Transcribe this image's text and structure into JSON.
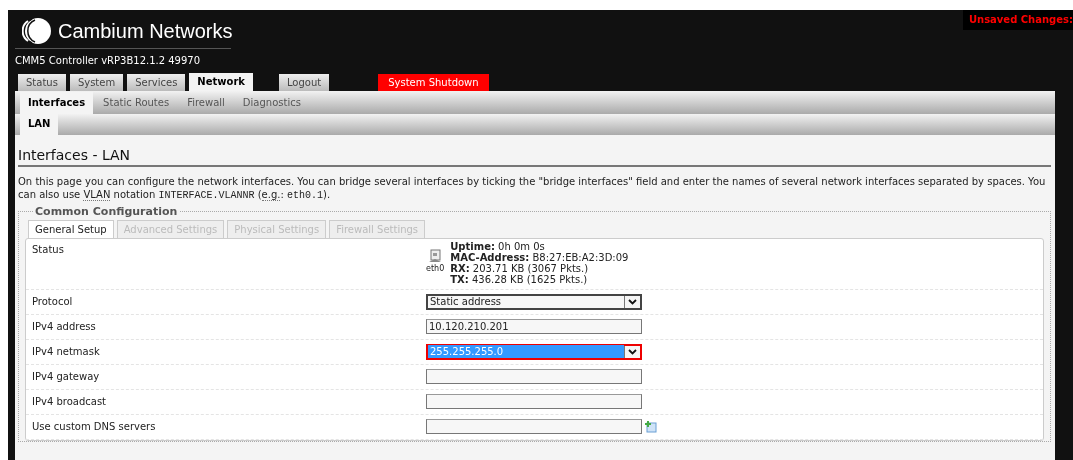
{
  "header": {
    "brand": "Cambium Networks",
    "subtitle": "CMM5 Controller vRP3B12.1.2 49970",
    "unsaved": "Unsaved Changes: "
  },
  "main_tabs": [
    {
      "label": "Status",
      "selected": false,
      "kind": "tab"
    },
    {
      "label": "System",
      "selected": false,
      "kind": "tab"
    },
    {
      "label": "Services",
      "selected": false,
      "kind": "tab"
    },
    {
      "label": "Network",
      "selected": true,
      "kind": "tab"
    },
    {
      "label": "Logout",
      "selected": false,
      "kind": "logout"
    },
    {
      "label": "System Shutdown",
      "selected": false,
      "kind": "danger"
    }
  ],
  "sub_tabs": [
    {
      "label": "Interfaces",
      "selected": true
    },
    {
      "label": "Static Routes",
      "selected": false
    },
    {
      "label": "Firewall",
      "selected": false
    },
    {
      "label": "Diagnostics",
      "selected": false
    }
  ],
  "iface_tabs": [
    {
      "label": "LAN",
      "selected": true
    }
  ],
  "page_title": "Interfaces - LAN",
  "description": [
    {
      "kind": "text",
      "text": "On this page you can configure the network interfaces. You can bridge several interfaces by ticking the \"bridge interfaces\" field and enter the names of several network interfaces separated by spaces. You can also use "
    },
    {
      "kind": "abbr",
      "text": "VLAN"
    },
    {
      "kind": "text",
      "text": " notation "
    },
    {
      "kind": "code",
      "text": "INTERFACE.VLANNR"
    },
    {
      "kind": "text",
      "text": " ("
    },
    {
      "kind": "abbr",
      "text": "e.g."
    },
    {
      "kind": "text",
      "text": ": "
    },
    {
      "kind": "code",
      "text": "eth0.1"
    },
    {
      "kind": "text",
      "text": ")."
    }
  ],
  "section": {
    "legend": "Common Configuration",
    "tabs": [
      {
        "label": "General Setup",
        "selected": true
      },
      {
        "label": "Advanced Settings",
        "selected": false
      },
      {
        "label": "Physical Settings",
        "selected": false
      },
      {
        "label": "Firewall Settings",
        "selected": false
      }
    ],
    "status": {
      "label": "Status",
      "device": "eth0",
      "lines": [
        {
          "label": "Uptime:",
          "value": " 0h 0m 0s"
        },
        {
          "label": "MAC-Address:",
          "value": " B8:27:EB:A2:3D:09"
        },
        {
          "label": "RX:",
          "value": " 203.71 KB (3067 Pkts.)"
        },
        {
          "label": "TX:",
          "value": " 436.28 KB (1625 Pkts.)"
        }
      ]
    },
    "fields": [
      {
        "label": "Protocol",
        "kind": "select",
        "value": "Static address",
        "focused": false
      },
      {
        "label": "IPv4 address",
        "kind": "input",
        "value": "10.120.210.201",
        "focused": false
      },
      {
        "label": "IPv4 netmask",
        "kind": "select",
        "value": "255.255.255.0",
        "focused": true
      },
      {
        "label": "IPv4 gateway",
        "kind": "input",
        "focused": false
      },
      {
        "label": "IPv4 broadcast",
        "kind": "input",
        "focused": false
      },
      {
        "label": "Use custom DNS servers",
        "kind": "dynlist",
        "focused": false
      }
    ]
  }
}
